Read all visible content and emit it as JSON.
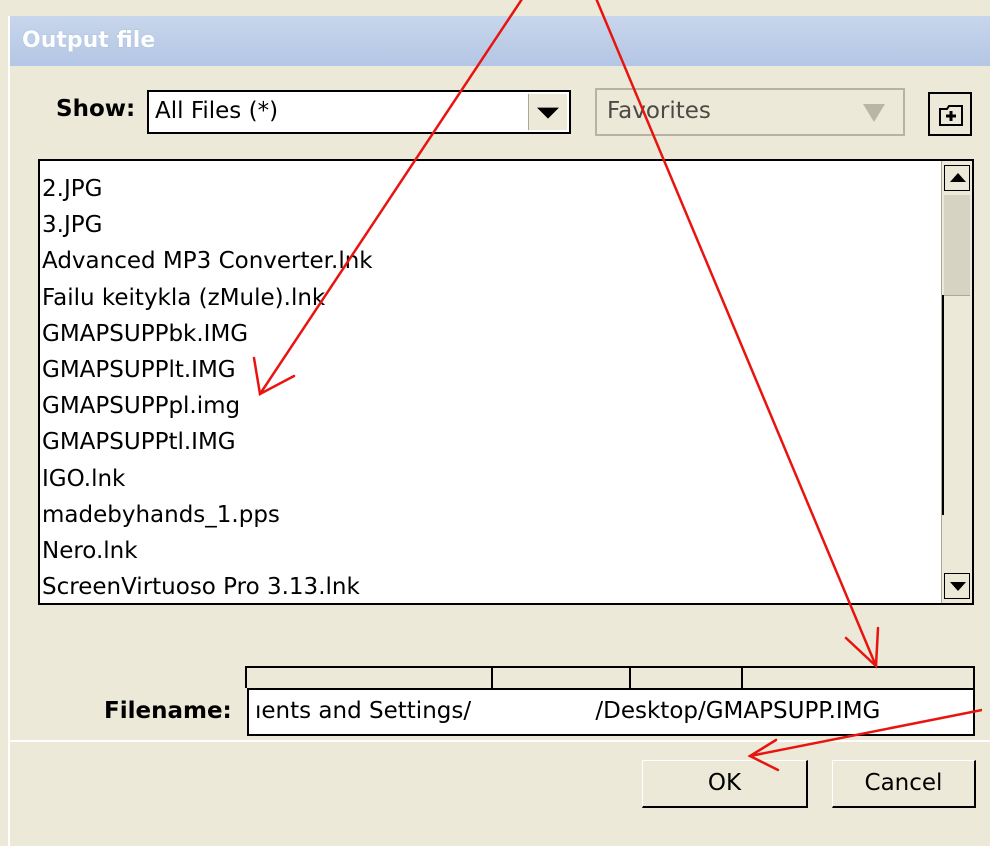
{
  "window": {
    "title": "Output file"
  },
  "toolbar": {
    "show_label": "Show:",
    "filter_value": "All Files (*)",
    "location_value": "Favorites"
  },
  "file_list": {
    "items": [
      "2.JPG",
      "3.JPG",
      "Advanced MP3 Converter.lnk",
      "Failu keitykla (zMule).lnk",
      "GMAPSUPPbk.IMG",
      "GMAPSUPPlt.IMG",
      "GMAPSUPPpl.img",
      "GMAPSUPPtl.IMG",
      "IGO.lnk",
      "madebyhands_1.pps",
      "Nero.lnk",
      "ScreenVirtuoso Pro 3.13.lnk"
    ]
  },
  "filename": {
    "label": "Filename:",
    "value": "ıents and Settings/                 /Desktop/GMAPSUPP.IMG"
  },
  "buttons": {
    "ok": "OK",
    "cancel": "Cancel"
  },
  "colors": {
    "annotation_arrow": "#e8140f",
    "dialog_bg": "#ece9d8",
    "titlebar": "#b8c9e6"
  },
  "icons": [
    "chevron-down-icon",
    "new-folder-icon",
    "scroll-up-icon",
    "scroll-down-icon"
  ]
}
